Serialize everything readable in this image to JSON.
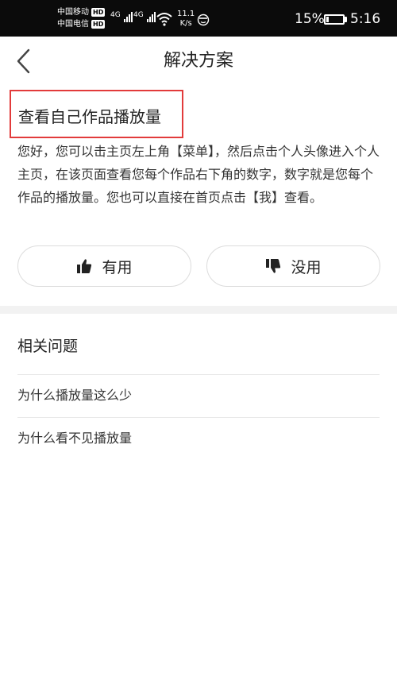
{
  "status_bar": {
    "carrier1": "中国移动",
    "carrier2": "中国电信",
    "hd_badge": "HD",
    "network1": "4G",
    "network2": "4G",
    "speed_value": "11.1",
    "speed_unit": "K/s",
    "battery_percent": "15%",
    "battery_level": 0.15,
    "time": "5:16"
  },
  "header": {
    "back_icon": "chevron-left-icon",
    "title": "解决方案"
  },
  "answer": {
    "title": "查看自己作品播放量",
    "body": "您好，您可以击主页左上角【菜单】，然后点击个人头像进入个人主页，在该页面查看您每个作品右下角的数字，数字就是您每个作品的播放量。您也可以直接在首页点击【我】查看。",
    "highlight_color": "#e23b3b"
  },
  "feedback": {
    "useful_label": "有用",
    "useful_icon": "thumbs-up-icon",
    "useless_label": "没用",
    "useless_icon": "thumbs-down-icon"
  },
  "related": {
    "title": "相关问题",
    "items": [
      {
        "label": "为什么播放量这么少"
      },
      {
        "label": "为什么看不见播放量"
      }
    ]
  }
}
